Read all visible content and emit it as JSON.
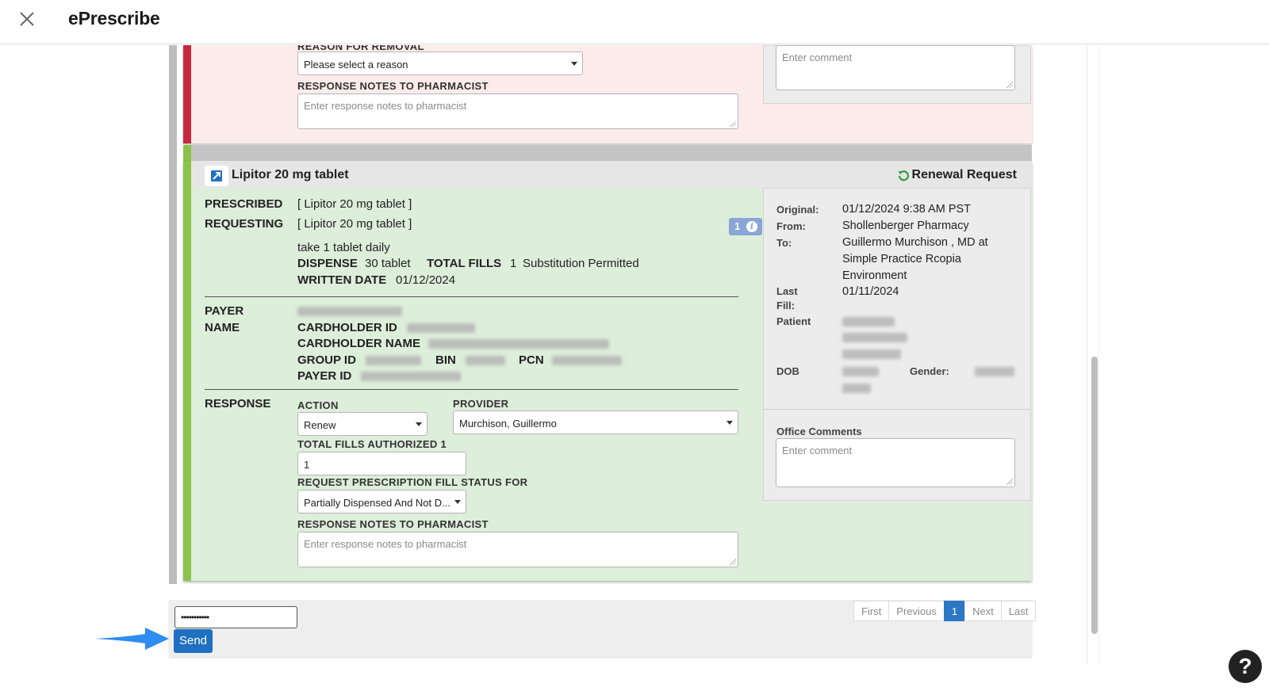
{
  "app": {
    "title": "ePrescribe"
  },
  "prev_card": {
    "reason_label": "REASON FOR REMOVAL",
    "reason_value": "Please select a reason",
    "notes_label": "RESPONSE NOTES TO PHARMACIST",
    "notes_placeholder": "Enter response notes to pharmacist",
    "comment_placeholder": "Enter comment",
    "stripe_color": "#c8283e"
  },
  "card": {
    "drug": "Lipitor 20 mg tablet",
    "request_type": "Renewal Request",
    "prescribed_label": "PRESCRIBED",
    "prescribed_value": "[ Lipitor 20 mg tablet ]",
    "requesting_label": "REQUESTING",
    "requesting_value": "[ Lipitor 20 mg tablet ]",
    "badge_count": "1",
    "sig": "take 1 tablet daily",
    "dispense_label": "DISPENSE",
    "dispense_value": "30 tablet",
    "total_fills_label": "TOTAL FILLS",
    "total_fills_value": "1",
    "substitution": "Substitution Permitted",
    "written_date_label": "WRITTEN DATE",
    "written_date_value": "01/12/2024",
    "payer_name_label_1": "PAYER",
    "payer_name_label_2": "NAME",
    "cardholder_id_label": "CARDHOLDER ID",
    "cardholder_name_label": "CARDHOLDER NAME",
    "group_id_label": "GROUP ID",
    "bin_label": "BIN",
    "pcn_label": "PCN",
    "payer_id_label": "PAYER ID",
    "response_label": "RESPONSE",
    "action_label": "ACTION",
    "action_value": "Renew",
    "provider_label": "PROVIDER",
    "provider_value": "Murchison, Guillermo",
    "total_fills_authorized_label": "TOTAL FILLS AUTHORIZED 1",
    "total_fills_authorized_value": "1",
    "fill_status_label": "REQUEST PRESCRIPTION FILL STATUS FOR",
    "fill_status_value": "Partially Dispensed And Not D...",
    "notes_label": "RESPONSE NOTES TO PHARMACIST",
    "notes_placeholder": "Enter response notes to pharmacist",
    "stripe_color": "#8bc34a",
    "background_color": "#ddeeda"
  },
  "side": {
    "original_label": "Original:",
    "original_value": "01/12/2024 9:38 AM PST",
    "from_label": "From:",
    "from_value": "Shollenberger Pharmacy",
    "to_label": "To:",
    "to_line1": "Guillermo Murchison , MD at",
    "to_line2": "Simple Practice Rcopia",
    "to_line3": "Environment",
    "last_fill_label_1": "Last",
    "last_fill_label_2": "Fill:",
    "last_fill_value": "01/11/2024",
    "patient_label": "Patient",
    "dob_label": "DOB",
    "gender_label": "Gender:",
    "office_comments_label": "Office Comments",
    "office_comments_placeholder": "Enter comment"
  },
  "footer": {
    "password_mask": "•••••••••••",
    "send_label": "Send",
    "pager": {
      "first": "First",
      "previous": "Previous",
      "current": "1",
      "next": "Next",
      "last": "Last"
    },
    "accent_color": "#1f70c1"
  },
  "help": {
    "label": "?"
  }
}
